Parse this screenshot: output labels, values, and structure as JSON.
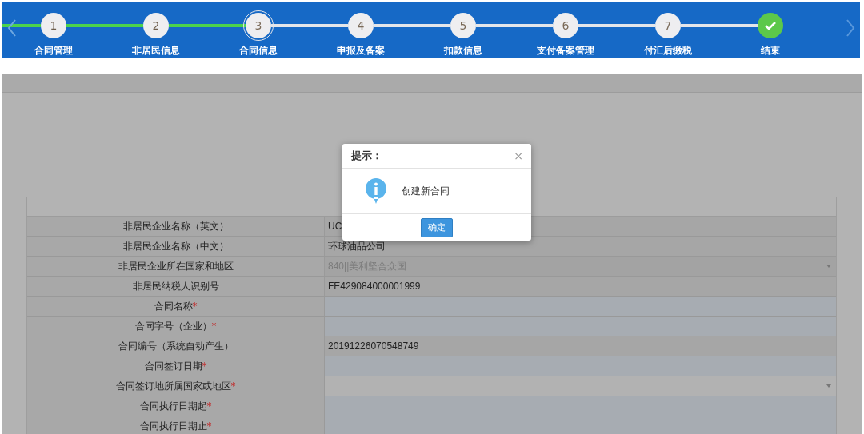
{
  "steps": [
    {
      "kind": "number",
      "number": "1",
      "label": "合同管理",
      "done": true,
      "selected": false
    },
    {
      "kind": "number",
      "number": "2",
      "label": "非居民信息",
      "done": true,
      "selected": false
    },
    {
      "kind": "number",
      "number": "3",
      "label": "合同信息",
      "done": false,
      "selected": true
    },
    {
      "kind": "number",
      "number": "4",
      "label": "申报及备案",
      "done": false,
      "selected": false
    },
    {
      "kind": "number",
      "number": "5",
      "label": "扣款信息",
      "done": false,
      "selected": false
    },
    {
      "kind": "number",
      "number": "6",
      "label": "支付备案管理",
      "done": false,
      "selected": false
    },
    {
      "kind": "number",
      "number": "7",
      "label": "付汇后缴税",
      "done": false,
      "selected": false
    },
    {
      "kind": "end",
      "label": "结束",
      "done": false,
      "selected": false
    }
  ],
  "form": {
    "rows": [
      {
        "label": "非居民企业名称（英文）",
        "kind": "text",
        "value": "UC"
      },
      {
        "label": "非居民企业名称（中文）",
        "kind": "text",
        "value": "环球油品公司"
      },
      {
        "label": "非居民企业所在国家和地区",
        "kind": "select",
        "disabled": true,
        "value": "840||美利坚合众国"
      },
      {
        "label": "非居民纳税人识别号",
        "kind": "text",
        "value": "FE429084000001999"
      },
      {
        "label": "合同名称",
        "mark": "*",
        "kind": "input"
      },
      {
        "label": "合同字号（企业）",
        "mark": "*",
        "kind": "input"
      },
      {
        "label": "合同编号（系统自动产生）",
        "kind": "text",
        "value": "20191226070548749"
      },
      {
        "label": "合同签订日期",
        "mark": "*",
        "kind": "input"
      },
      {
        "label": "合同签订地所属国家或地区",
        "mark": "*",
        "kind": "select",
        "disabled": false
      },
      {
        "label": "合同执行日期起",
        "mark": "*",
        "kind": "input"
      },
      {
        "label": "合同执行日期止",
        "mark": "*",
        "kind": "input"
      }
    ]
  },
  "dialog": {
    "title": "提示：",
    "close": "×",
    "message": "创建新合同",
    "button": "确定"
  }
}
